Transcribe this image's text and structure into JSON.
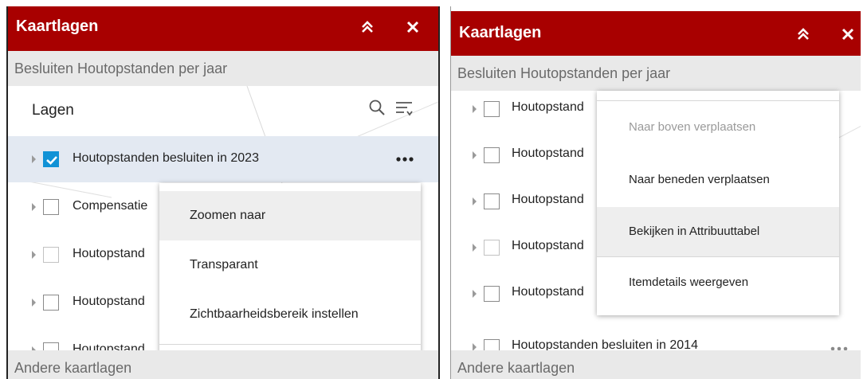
{
  "colors": {
    "header_bg": "#a80000",
    "checked": "#1192d6",
    "subbar_bg": "#e9e9e9"
  },
  "left_panel": {
    "title": "Kaartlagen",
    "collapse_icon": "double-chevron-up-icon",
    "close_icon": "close-icon",
    "subtitle": "Besluiten Houtopstanden per jaar",
    "section_label": "Lagen",
    "layers": [
      {
        "label": "Houtopstanden besluiten in 2023",
        "checked": true,
        "selected": true
      },
      {
        "label": "Compensatie",
        "checked": false
      },
      {
        "label": "Houtopstand",
        "checked": false,
        "disabled": true
      },
      {
        "label": "Houtopstand",
        "checked": false
      },
      {
        "label": "Houtopstand",
        "checked": false
      }
    ],
    "menu_items": [
      "Zoomen naar",
      "Transparant",
      "Zichtbaarheidsbereik instellen"
    ],
    "footer": "Andere kaartlagen"
  },
  "right_panel": {
    "title": "Kaartlagen",
    "subtitle": "Besluiten Houtopstanden per jaar",
    "layers": [
      {
        "label": "Houtopstand",
        "checked": false
      },
      {
        "label": "Houtopstand",
        "checked": false
      },
      {
        "label": "Houtopstand",
        "checked": false
      },
      {
        "label": "Houtopstand",
        "checked": false,
        "disabled": true
      },
      {
        "label": "Houtopstand",
        "checked": false
      },
      {
        "label": "Houtopstanden besluiten in 2014",
        "checked": false
      }
    ],
    "menu_items": [
      "Naar boven verplaatsen",
      "Naar beneden verplaatsen",
      "Bekijken in Attribuuttabel",
      "Itemdetails weergeven"
    ],
    "footer": "Andere kaartlagen"
  }
}
